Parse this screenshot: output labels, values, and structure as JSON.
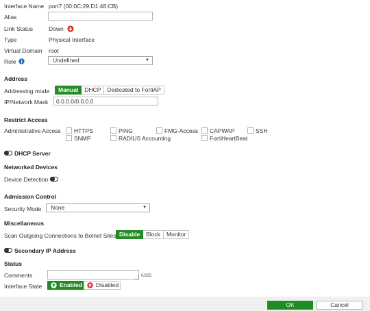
{
  "general": {
    "interface_name_label": "Interface Name",
    "interface_name_value": "port7 (00:0C:29:D1:48:CB)",
    "alias_label": "Alias",
    "alias_value": "",
    "link_status_label": "Link Status",
    "link_status_value": "Down",
    "type_label": "Type",
    "type_value": "Physical Interface",
    "vdom_label": "Virtual Domain",
    "vdom_value": "root",
    "role_label": "Role",
    "role_value": "Undefined"
  },
  "address": {
    "title": "Address",
    "mode_label": "Addressing mode",
    "modes": [
      "Manual",
      "DHCP",
      "Dedicated to FortiAP"
    ],
    "selected_mode": "Manual",
    "ip_label": "IP/Network Mask",
    "ip_value": "0.0.0.0/0.0.0.0"
  },
  "restrict_access": {
    "title": "Restrict Access",
    "admin_access_label": "Administrative Access",
    "options": [
      "HTTPS",
      "PING",
      "FMG-Access",
      "CAPWAP",
      "SSH",
      "SNMP",
      "RADIUS Accounting",
      "FortiHeartBeat"
    ]
  },
  "dhcp_server_label": "DHCP Server",
  "networked_devices": {
    "title": "Networked Devices",
    "device_detection_label": "Device Detection"
  },
  "admission_control": {
    "title": "Admission Control",
    "security_mode_label": "Security Mode",
    "security_mode_value": "None"
  },
  "misc": {
    "title": "Miscellaneous",
    "botnet_label": "Scan Outgoing Connections to Botnet Sites",
    "botnet_options": [
      "Disable",
      "Block",
      "Monitor"
    ],
    "botnet_selected": "Disable",
    "secondary_ip_label": "Secondary IP Address"
  },
  "status": {
    "title": "Status",
    "comments_label": "Comments",
    "comments_value": "",
    "comments_counter": "0/255",
    "interface_state_label": "Interface State",
    "enabled_label": "Enabled",
    "disabled_label": "Disabled"
  },
  "footer": {
    "ok_label": "OK",
    "cancel_label": "Cancel"
  },
  "colors": {
    "accent_green": "#238b23",
    "status_red": "#d9302c",
    "info_blue": "#2a6ebb"
  },
  "icons": {
    "link_status": "down-circle-icon",
    "role_info": "info-icon",
    "enabled": "up-arrow-circle-icon",
    "disabled": "close-circle-icon"
  }
}
